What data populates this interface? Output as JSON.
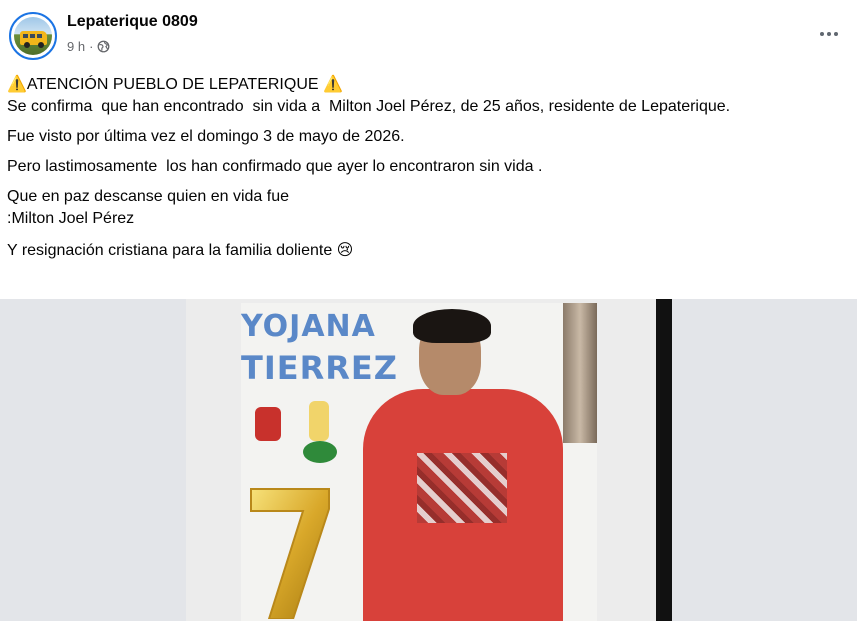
{
  "post": {
    "page_name": "Lepaterique 0809",
    "time": "9 h",
    "separator": "·",
    "privacy_icon": "globe-icon",
    "more_icon": "more-options-icon"
  },
  "content": {
    "line1": "⚠️ATENCIÓN PUEBLO DE LEPATERIQUE ⚠️",
    "line2": "Se confirma  que han encontrado  sin vida a  Milton Joel Pérez, de 25 años, residente de Lepaterique.",
    "line3": "Fue visto por última vez el domingo 3 de mayo de 2026.",
    "line4": "Pero lastimosamente  los han confirmado que ayer lo encontraron sin vida .",
    "line5": "Que en paz descanse quien en vida fue",
    "line6": ":Milton Joel Pérez",
    "line7": "Y resignación cristiana para la familia doliente 😢"
  },
  "photo": {
    "wall_text_1": "YOJANA",
    "wall_text_2": "TIERREZ",
    "balloon_digit": "7"
  },
  "colors": {
    "accent": "#1b74e4",
    "secondary_text": "#65676b",
    "hoodie": "#d8413a"
  }
}
